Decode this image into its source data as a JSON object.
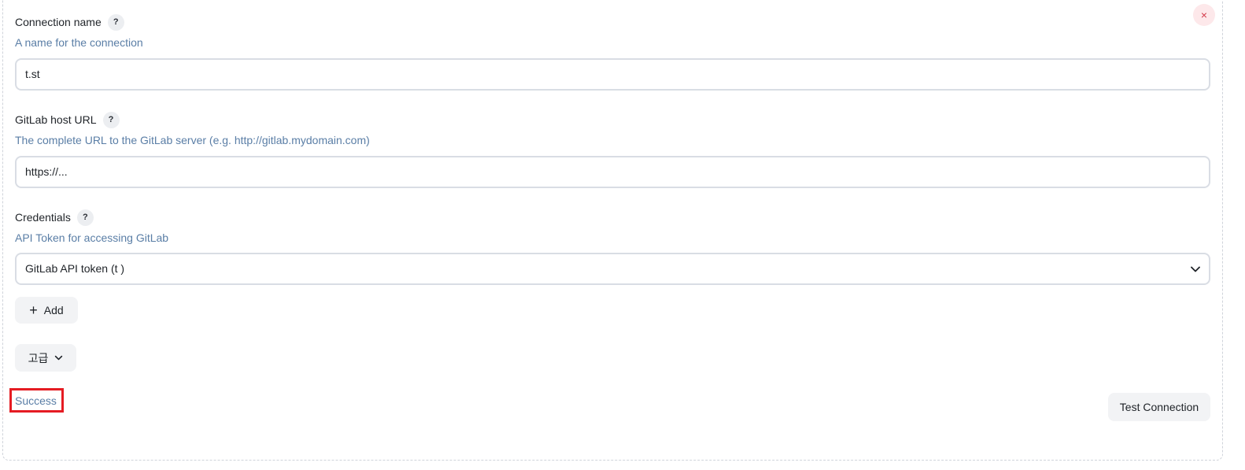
{
  "close_icon_glyph": "×",
  "fields": {
    "connection_name": {
      "label": "Connection name",
      "help": "?",
      "description": "A name for the connection",
      "value": "t.st"
    },
    "gitlab_host_url": {
      "label": "GitLab host URL",
      "help": "?",
      "description": "The complete URL to the GitLab server (e.g. http://gitlab.mydomain.com)",
      "value": "https://..."
    },
    "credentials": {
      "label": "Credentials",
      "help": "?",
      "description": "API Token for accessing GitLab",
      "selected": "GitLab API token (t   )"
    }
  },
  "buttons": {
    "add": "Add",
    "add_icon": "+",
    "advanced": "고급",
    "test_connection": "Test Connection"
  },
  "status": {
    "text": "Success",
    "highlight_color": "#e51c23"
  },
  "colors": {
    "description_text": "#5a7ea6",
    "close_button_bg": "#fde8ea",
    "close_button_fg": "#d33a4a"
  }
}
